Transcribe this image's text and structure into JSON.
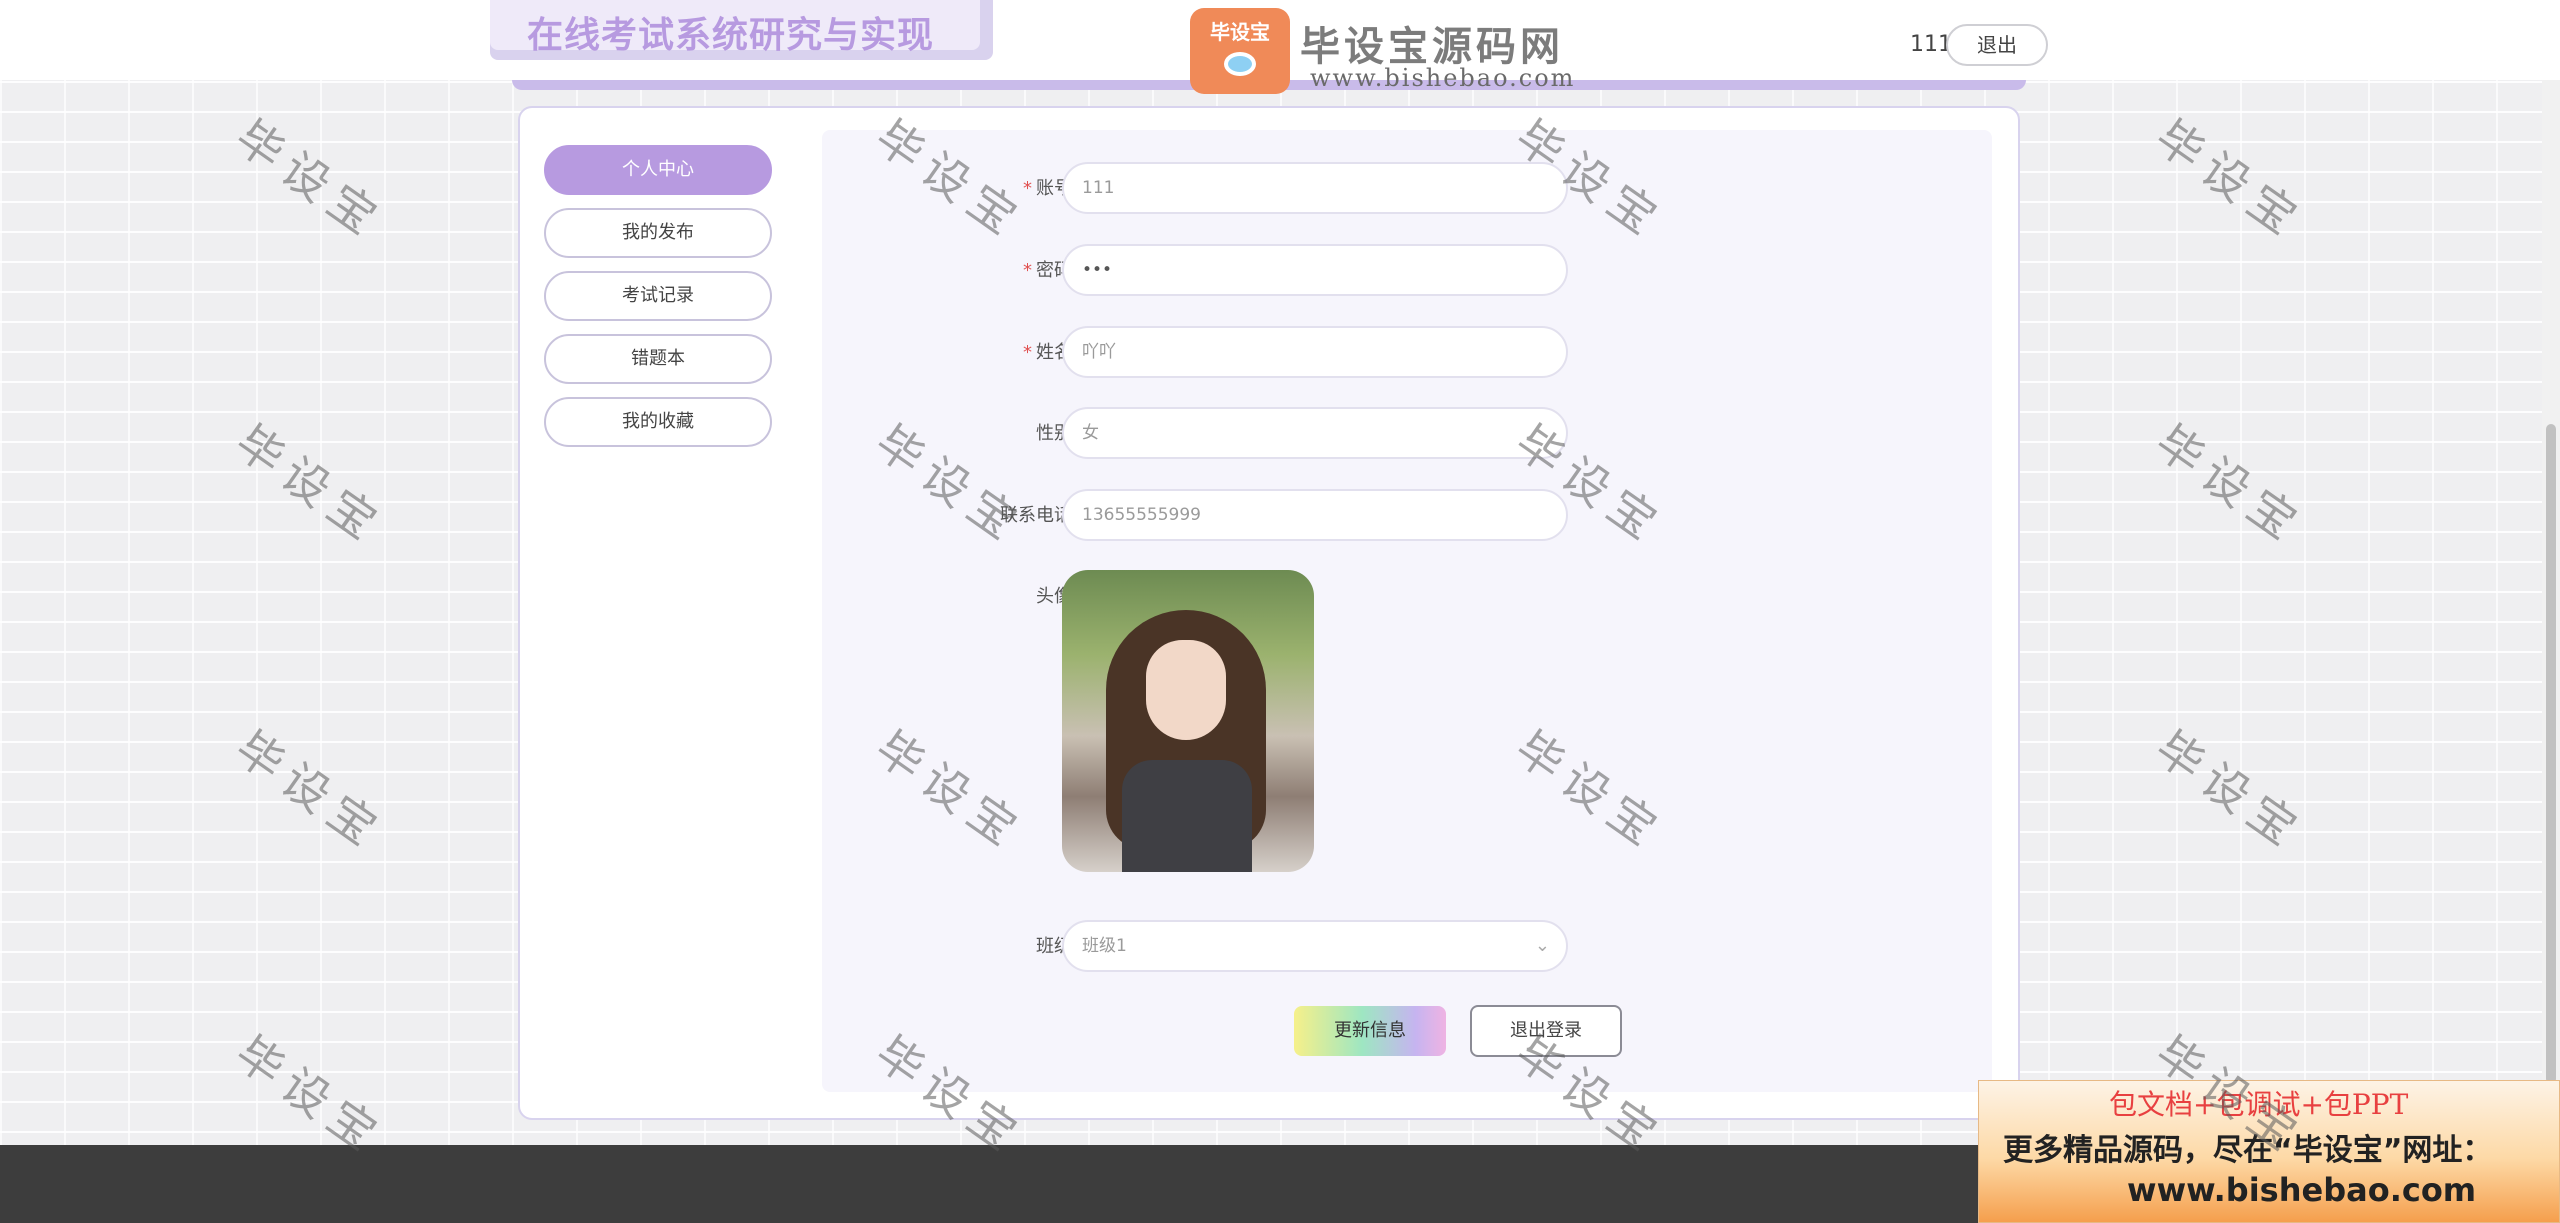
{
  "header": {
    "site_title": "在线考试系统研究与实现",
    "logo_badge": "毕设宝",
    "logo_text": "毕设宝源码网",
    "logo_url": "www.bishebao.com",
    "username": "111",
    "logout_label": "退出",
    "accent_color": "#b79ae0"
  },
  "sidebar": {
    "items": [
      {
        "label": "个人中心",
        "active": true
      },
      {
        "label": "我的发布",
        "active": false
      },
      {
        "label": "考试记录",
        "active": false
      },
      {
        "label": "错题本",
        "active": false
      },
      {
        "label": "我的收藏",
        "active": false
      }
    ]
  },
  "form": {
    "account": {
      "label": "账号",
      "value": "111"
    },
    "password": {
      "label": "密码",
      "value": "•••"
    },
    "name": {
      "label": "姓名",
      "value": "吖吖"
    },
    "gender": {
      "label": "性别",
      "value": "女"
    },
    "phone": {
      "label": "联系电话",
      "value": "13655555999"
    },
    "avatar": {
      "label": "头像"
    },
    "class": {
      "label": "班级",
      "value": "班级1",
      "icon": "chevron-down-icon"
    },
    "update_button": "更新信息",
    "logout_button": "退出登录"
  },
  "watermark": "毕设宝",
  "ad": {
    "line1": "包文档+包调试+包PPT",
    "line2": "更多精品源码，尽在“毕设宝”网址：",
    "line3": "www.bishebao.com"
  }
}
